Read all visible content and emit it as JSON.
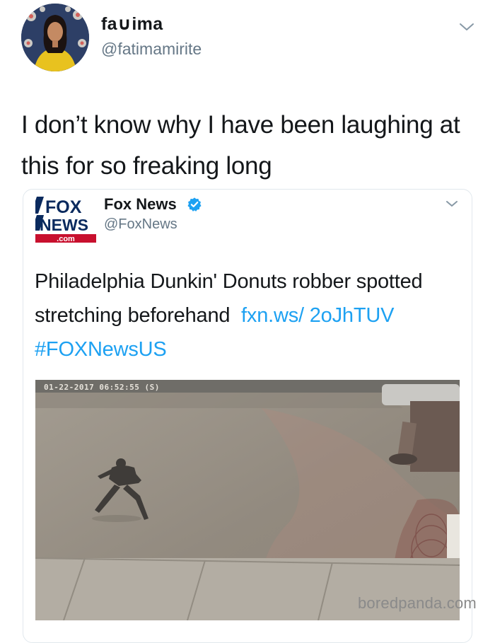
{
  "tweet": {
    "display_name": "fa∪ima",
    "handle": "@fatimamirite",
    "text": "I don’t know why I have been laughing at this for so freaking long"
  },
  "quoted_tweet": {
    "logo_top": "FOX",
    "logo_bottom": "NEWS",
    "logo_domain": ".com",
    "display_name": "Fox News",
    "handle": "@FoxNews",
    "text": "Philadelphia Dunkin' Donuts robber spotted stretching beforehand",
    "link_text": "fxn.ws/ 2oJhTUV",
    "hashtag": "#FOXNewsUS",
    "video_timestamp": "01-22-2017 06:52:55 (S)"
  },
  "watermark": "boredpanda.com",
  "colors": {
    "link": "#1da1f2",
    "verified": "#1da1f2",
    "fox_red": "#c8102e",
    "fox_blue": "#0a2a5e"
  },
  "icons": [
    "avatar",
    "chevron-down-icon",
    "fox-news-logo",
    "verified-badge-icon"
  ]
}
